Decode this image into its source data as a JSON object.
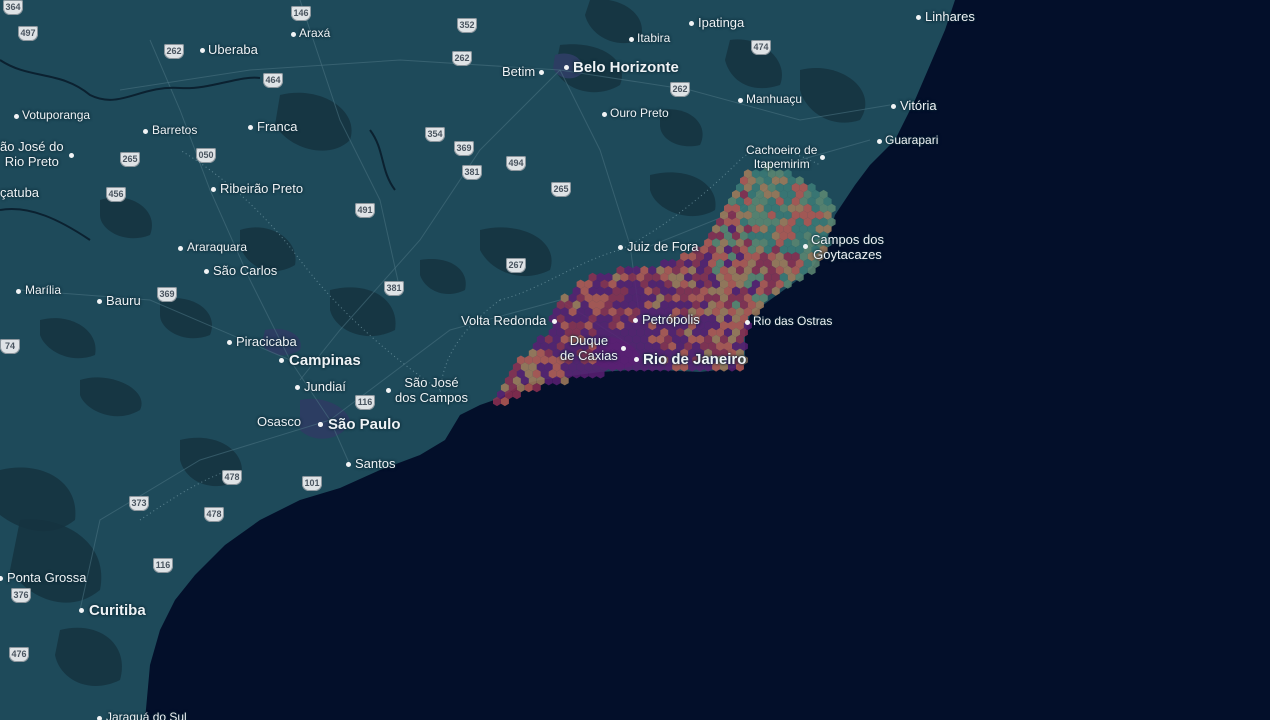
{
  "map": {
    "colors": {
      "ocean": "#030f2a",
      "land": "#1e4a5a",
      "forest": "#15333f",
      "urban": "#2c3d62",
      "label": "#eef2f5",
      "hex_palette": [
        "#3d7c78",
        "#5e8a73",
        "#a47e5c",
        "#b85a55",
        "#8e2f52",
        "#5a1f73"
      ]
    },
    "cities": [
      {
        "name": "Linhares",
        "size": "medium"
      },
      {
        "name": "Ipatinga",
        "size": "medium"
      },
      {
        "name": "Itabira",
        "size": "small"
      },
      {
        "name": "Uberaba",
        "size": "medium"
      },
      {
        "name": "Araxá",
        "size": "small"
      },
      {
        "name": "Belo Horizonte",
        "size": "large"
      },
      {
        "name": "Betim",
        "size": "medium"
      },
      {
        "name": "Manhuaçu",
        "size": "small"
      },
      {
        "name": "Vitória",
        "size": "medium"
      },
      {
        "name": "Votuporanga",
        "size": "small"
      },
      {
        "name": "Barretos",
        "size": "small"
      },
      {
        "name": "Franca",
        "size": "medium"
      },
      {
        "name": "Ouro Preto",
        "size": "small"
      },
      {
        "name": "Guarapari",
        "size": "small"
      },
      {
        "name": "ão José do\nRio Preto",
        "size": "medium"
      },
      {
        "name": "Cachoeiro de\nItapemirim",
        "size": "small"
      },
      {
        "name": "çatuba",
        "size": "medium"
      },
      {
        "name": "Ribeirão Preto",
        "size": "medium"
      },
      {
        "name": "Juiz de Fora",
        "size": "medium"
      },
      {
        "name": "Campos dos\nGoytacazes",
        "size": "medium"
      },
      {
        "name": "Araraquara",
        "size": "small"
      },
      {
        "name": "São Carlos",
        "size": "medium"
      },
      {
        "name": "Marília",
        "size": "small"
      },
      {
        "name": "Bauru",
        "size": "medium"
      },
      {
        "name": "Volta Redonda",
        "size": "medium"
      },
      {
        "name": "Petrópolis",
        "size": "medium"
      },
      {
        "name": "Rio das Ostras",
        "size": "small"
      },
      {
        "name": "Piracicaba",
        "size": "medium"
      },
      {
        "name": "Duque\nde Caxias",
        "size": "medium"
      },
      {
        "name": "Rio de Janeiro",
        "size": "large"
      },
      {
        "name": "Campinas",
        "size": "large"
      },
      {
        "name": "Jundiaí",
        "size": "medium"
      },
      {
        "name": "São José\ndos Campos",
        "size": "medium"
      },
      {
        "name": "Osasco",
        "size": "medium"
      },
      {
        "name": "São Paulo",
        "size": "large"
      },
      {
        "name": "Santos",
        "size": "medium"
      },
      {
        "name": "Ponta Grossa",
        "size": "medium"
      },
      {
        "name": "Curitiba",
        "size": "large"
      },
      {
        "name": "Jaraguá do Sul",
        "size": "small"
      }
    ],
    "shields": [
      "364",
      "146",
      "352",
      "497",
      "262",
      "464",
      "474",
      "262",
      "262",
      "354",
      "369",
      "050",
      "265",
      "381",
      "494",
      "456",
      "265",
      "491",
      "267",
      "369",
      "381",
      "74",
      "116",
      "478",
      "101",
      "373",
      "478",
      "116",
      "376",
      "476"
    ]
  }
}
